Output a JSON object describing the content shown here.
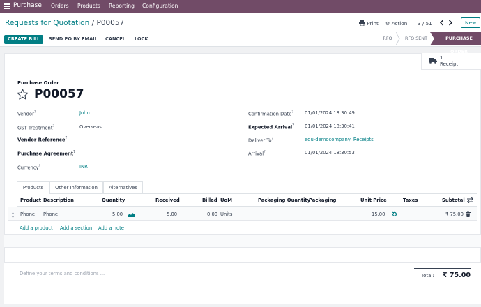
{
  "nav": {
    "app": "Purchase",
    "menu": [
      "Orders",
      "Products",
      "Reporting",
      "Configuration"
    ]
  },
  "breadcrumb": {
    "parent": "Requests for Quotation",
    "sep": "/",
    "current": "P00057"
  },
  "toolbar": {
    "print": "Print",
    "action": "Action",
    "pager": "3 / 51",
    "new": "New"
  },
  "buttons": {
    "create_bill": "CREATE BILL",
    "send_po": "SEND PO BY EMAIL",
    "cancel": "CANCEL",
    "lock": "LOCK"
  },
  "statusbar": {
    "rfq": "RFQ",
    "rfq_sent": "RFQ SENT",
    "purchase_order": "PURCHASE ORDER"
  },
  "smart": {
    "count": "1",
    "label": "Receipt"
  },
  "form": {
    "subtitle": "Purchase Order",
    "name": "P00057",
    "left": [
      {
        "label": "Vendor",
        "value": "John"
      },
      {
        "label": "GST Treatment",
        "value": "Overseas"
      },
      {
        "label": "Vendor Reference",
        "value": ""
      },
      {
        "label": "Purchase Agreement",
        "value": ""
      },
      {
        "label": "Currency",
        "value": "INR"
      }
    ],
    "right": [
      {
        "label": "Confirmation Date",
        "value": "01/01/2024 18:30:49"
      },
      {
        "label": "Expected Arrival",
        "value": "01/01/2024 18:30:41"
      },
      {
        "label": "Deliver To",
        "value": "edu-democompany: Receipts"
      },
      {
        "label": "Arrival",
        "value": "01/01/2024 18:30:53"
      }
    ],
    "sup": "?"
  },
  "tabs": [
    "Products",
    "Other Information",
    "Alternatives"
  ],
  "table": {
    "headers": {
      "product": "Product",
      "description": "Description",
      "quantity": "Quantity",
      "received": "Received",
      "billed": "Billed",
      "uom": "UoM",
      "pack_qty": "Packaging Quantity",
      "packaging": "Packaging",
      "unit_price": "Unit Price",
      "taxes": "Taxes",
      "subtotal": "Subtotal"
    },
    "row": {
      "product": "Phone",
      "description": "Phone",
      "quantity": "5.00",
      "received": "5.00",
      "billed": "0.00",
      "uom": "Units",
      "unit_price": "15.00",
      "subtotal": "₹ 75.00"
    },
    "add": [
      "Add a product",
      "Add a section",
      "Add a note"
    ]
  },
  "footer": {
    "terms_placeholder": "Define your terms and conditions ...",
    "total_label": "Total:",
    "total_value": "₹ 75.00"
  }
}
